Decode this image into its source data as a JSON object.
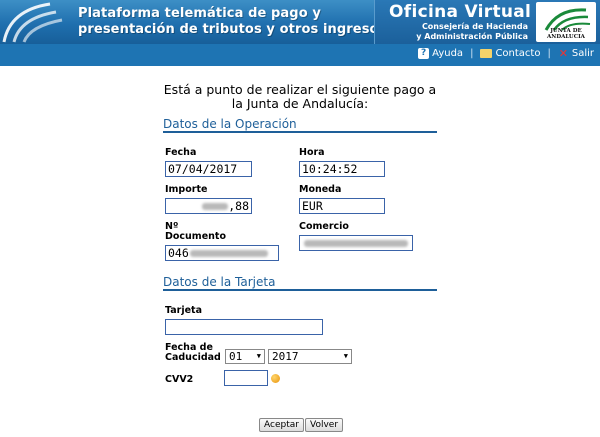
{
  "header": {
    "title_line1": "Plataforma telemática de pago y",
    "title_line2": "presentación de tributos y otros ingresos",
    "office_title": "Oficina Virtual",
    "office_sub1": "Consejería de Hacienda",
    "office_sub2": "y Administración Pública",
    "logo_text": "JUNTA DE ANDALUCIA",
    "logo_icon": "junta-andalucia-logo"
  },
  "toolbar": {
    "help": "Ayuda",
    "contact": "Contacto",
    "exit": "Salir",
    "separator": "|"
  },
  "intro": {
    "line1": "Está a punto de realizar el siguiente pago a",
    "line2": "la Junta de Andalucía:"
  },
  "operation": {
    "section_title": "Datos de la Operación",
    "date_label": "Fecha",
    "date_value": "07/04/2017",
    "time_label": "Hora",
    "time_value": "10:24:52",
    "amount_label": "Importe",
    "amount_suffix": ",88",
    "currency_label": "Moneda",
    "currency_value": "EUR",
    "doc_label_line1": "Nº",
    "doc_label_line2": "Documento",
    "doc_prefix": "046",
    "merchant_label": "Comercio"
  },
  "card": {
    "section_title": "Datos de la Tarjeta",
    "card_label": "Tarjeta",
    "card_value": "",
    "expiry_label_line1": "Fecha de",
    "expiry_label_line2": "Caducidad",
    "month_value": "01",
    "year_value": "2017",
    "cvv_label": "CVV2",
    "cvv_value": ""
  },
  "buttons": {
    "accept": "Aceptar",
    "back": "Volver"
  },
  "colors": {
    "banner": "#1f6fae",
    "section_title": "#1e5f99",
    "field_border": "#3a63a8"
  }
}
